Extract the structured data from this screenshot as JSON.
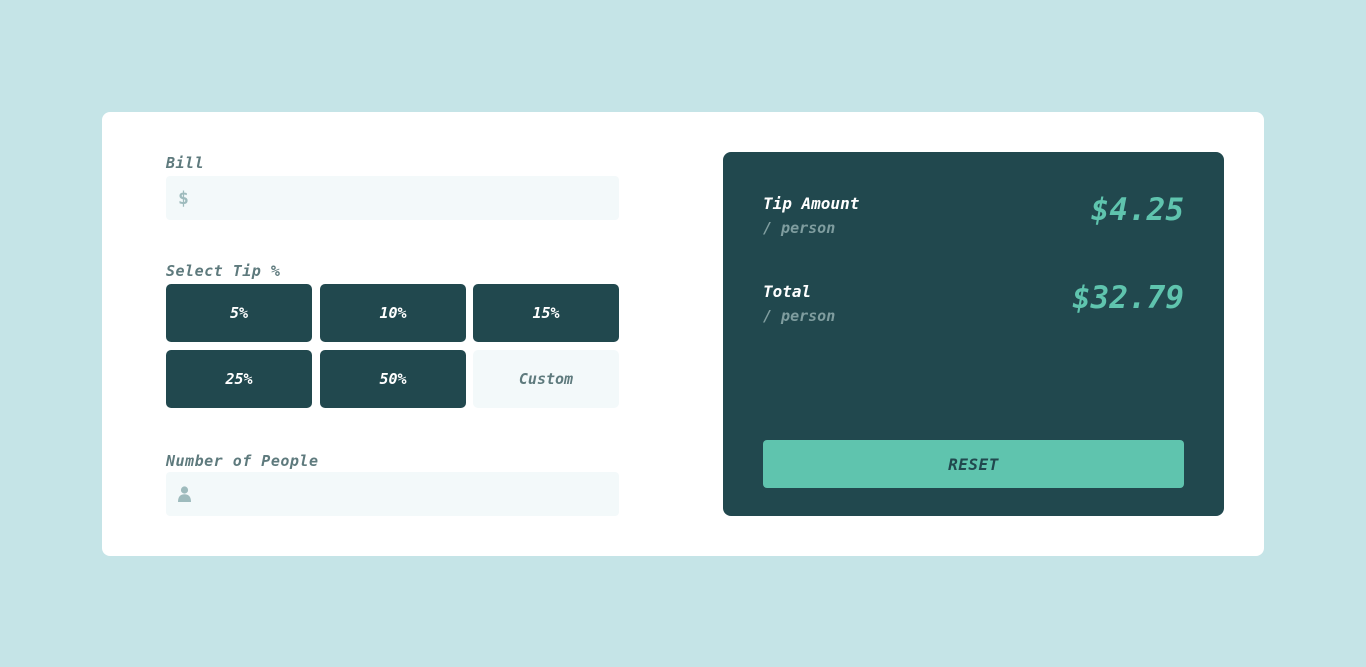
{
  "form": {
    "bill_label": "Bill",
    "bill_icon": "dollar-icon",
    "bill_icon_glyph": "$",
    "bill_value": "",
    "tip_label": "Select Tip %",
    "tips": [
      "5%",
      "10%",
      "15%",
      "25%",
      "50%"
    ],
    "custom_placeholder": "Custom",
    "people_label": "Number of People",
    "people_icon": "person-icon",
    "people_value": ""
  },
  "summary": {
    "tip_title": "Tip Amount",
    "tip_sub": "/ person",
    "tip_value": "$4.25",
    "total_title": "Total",
    "total_sub": "/ person",
    "total_value": "$32.79",
    "reset_label": "RESET"
  },
  "colors": {
    "background": "#c5e4e7",
    "dark_panel": "#21484e",
    "accent": "#5fc4ae",
    "input_bg": "#f3f9fa",
    "label": "#5e7a7d"
  }
}
